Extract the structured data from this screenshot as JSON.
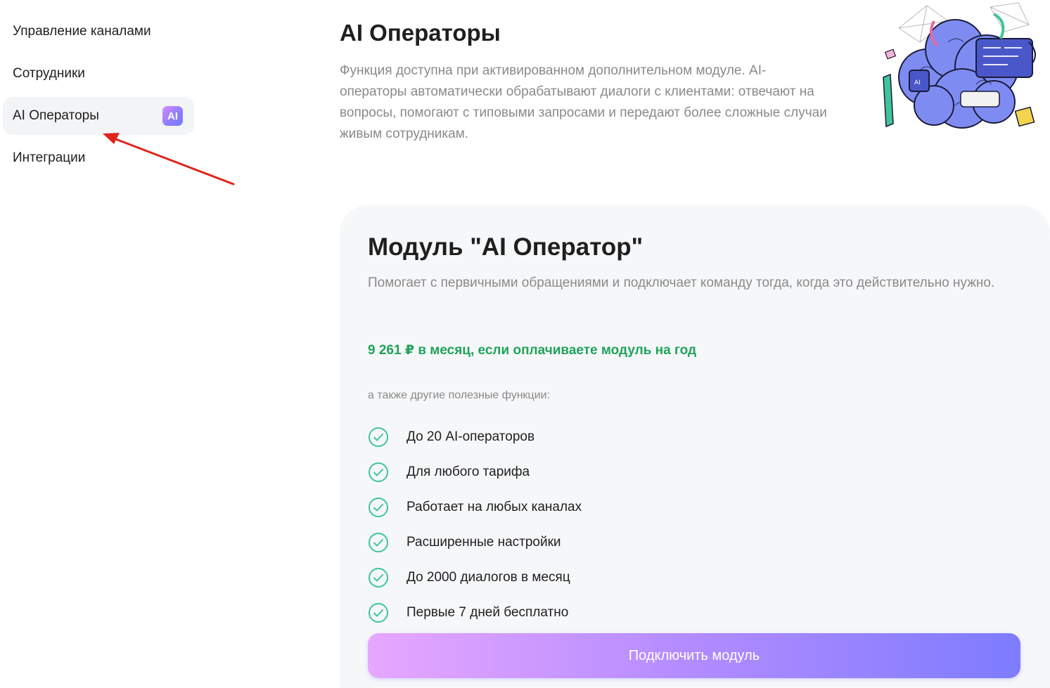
{
  "sidebar": {
    "items": [
      {
        "label": "Управление каналами",
        "active": false
      },
      {
        "label": "Сотрудники",
        "active": false
      },
      {
        "label": "AI Операторы",
        "active": true,
        "badge": "AI"
      },
      {
        "label": "Интеграции",
        "active": false
      }
    ]
  },
  "header": {
    "title": "AI Операторы",
    "description": "Функция доступна при активированном дополнительном модуле. AI-операторы автоматически обрабатывают диалоги с клиентами: отвечают на вопросы, помогают с типовыми запросами и передают более сложные случаи живым сотрудникам."
  },
  "module_card": {
    "title": "Модуль \"AI Оператор\"",
    "description": "Помогает с первичными обращениями и подключает команду тогда, когда это действительно нужно.",
    "price": "9 261 ₽ в месяц, если оплачиваете модуль на год",
    "features_caption": "а также другие полезные функции:",
    "features": [
      "До 20 AI-операторов",
      "Для любого тарифа",
      "Работает на любых каналах",
      "Расширенные настройки",
      "До 2000 диалогов в месяц",
      "Первые 7 дней бесплатно"
    ],
    "button_label": "Подключить модуль"
  },
  "colors": {
    "accent_green": "#1fa35b",
    "check_icon": "#3fc59a",
    "badge_gradient": [
      "#d58bff",
      "#6f7dff"
    ],
    "button_gradient": [
      "#e7a7ff",
      "#7d7cff"
    ],
    "annotation_arrow": "#e0241b"
  },
  "icons": {
    "feature_check": "check-circle-icon",
    "illustration": "ai-brain-illustration"
  }
}
